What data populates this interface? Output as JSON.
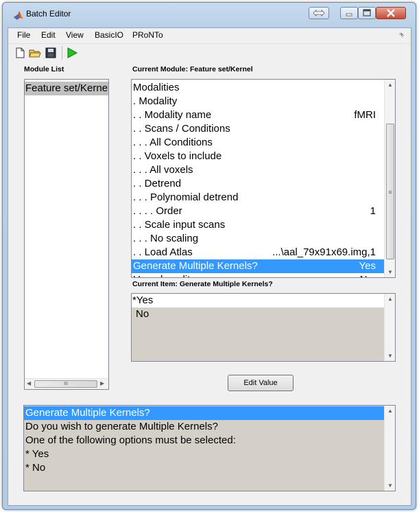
{
  "window": {
    "title": "Batch Editor"
  },
  "menu": [
    "File",
    "Edit",
    "View",
    "BasicIO",
    "PRoNTo"
  ],
  "menu_arrow": "⮷",
  "toolbar": {
    "icons": [
      "new-icon",
      "open-icon",
      "save-icon",
      "run-icon"
    ]
  },
  "module_list": {
    "label": "Module List",
    "items": [
      "Feature set/Kernel"
    ],
    "hscroll_grip": "III"
  },
  "current_module": {
    "label": "Current Module: Feature set/Kernel",
    "rows": [
      {
        "text": "Modalities",
        "value": ""
      },
      {
        "text": ". Modality",
        "value": ""
      },
      {
        "text": ". . Modality name",
        "value": "fMRI"
      },
      {
        "text": ". . Scans / Conditions",
        "value": ""
      },
      {
        "text": ". . . All Conditions",
        "value": ""
      },
      {
        "text": ". . Voxels to include",
        "value": ""
      },
      {
        "text": ". . . All voxels",
        "value": ""
      },
      {
        "text": ". . Detrend",
        "value": ""
      },
      {
        "text": ". . . Polynomial detrend",
        "value": ""
      },
      {
        "text": ". . . . Order",
        "value": "1"
      },
      {
        "text": ". . Scale input scans",
        "value": ""
      },
      {
        "text": ". . . No scaling",
        "value": ""
      },
      {
        "text": ". . Load Atlas",
        "value": "...\\aal_79x91x69.img,1"
      },
      {
        "text": "Generate Multiple Kernels?",
        "value": "Yes",
        "selected": true
      },
      {
        "text": "U... ...l.. ....lit...",
        "value": "N...",
        "partial": true
      }
    ],
    "scroll_grip": "≡"
  },
  "current_item": {
    "label": "Current Item: Generate Multiple Kernels?",
    "options": [
      "*Yes",
      "No"
    ]
  },
  "edit_value_button": "Edit Value",
  "help": {
    "lines": [
      "Generate Multiple Kernels?",
      "Do you wish to generate Multiple Kernels?",
      "One of the following options must be selected:",
      "* Yes",
      "* No"
    ]
  },
  "colors": {
    "selection": "#3399ff",
    "title_bg": "#b9cfe6"
  }
}
